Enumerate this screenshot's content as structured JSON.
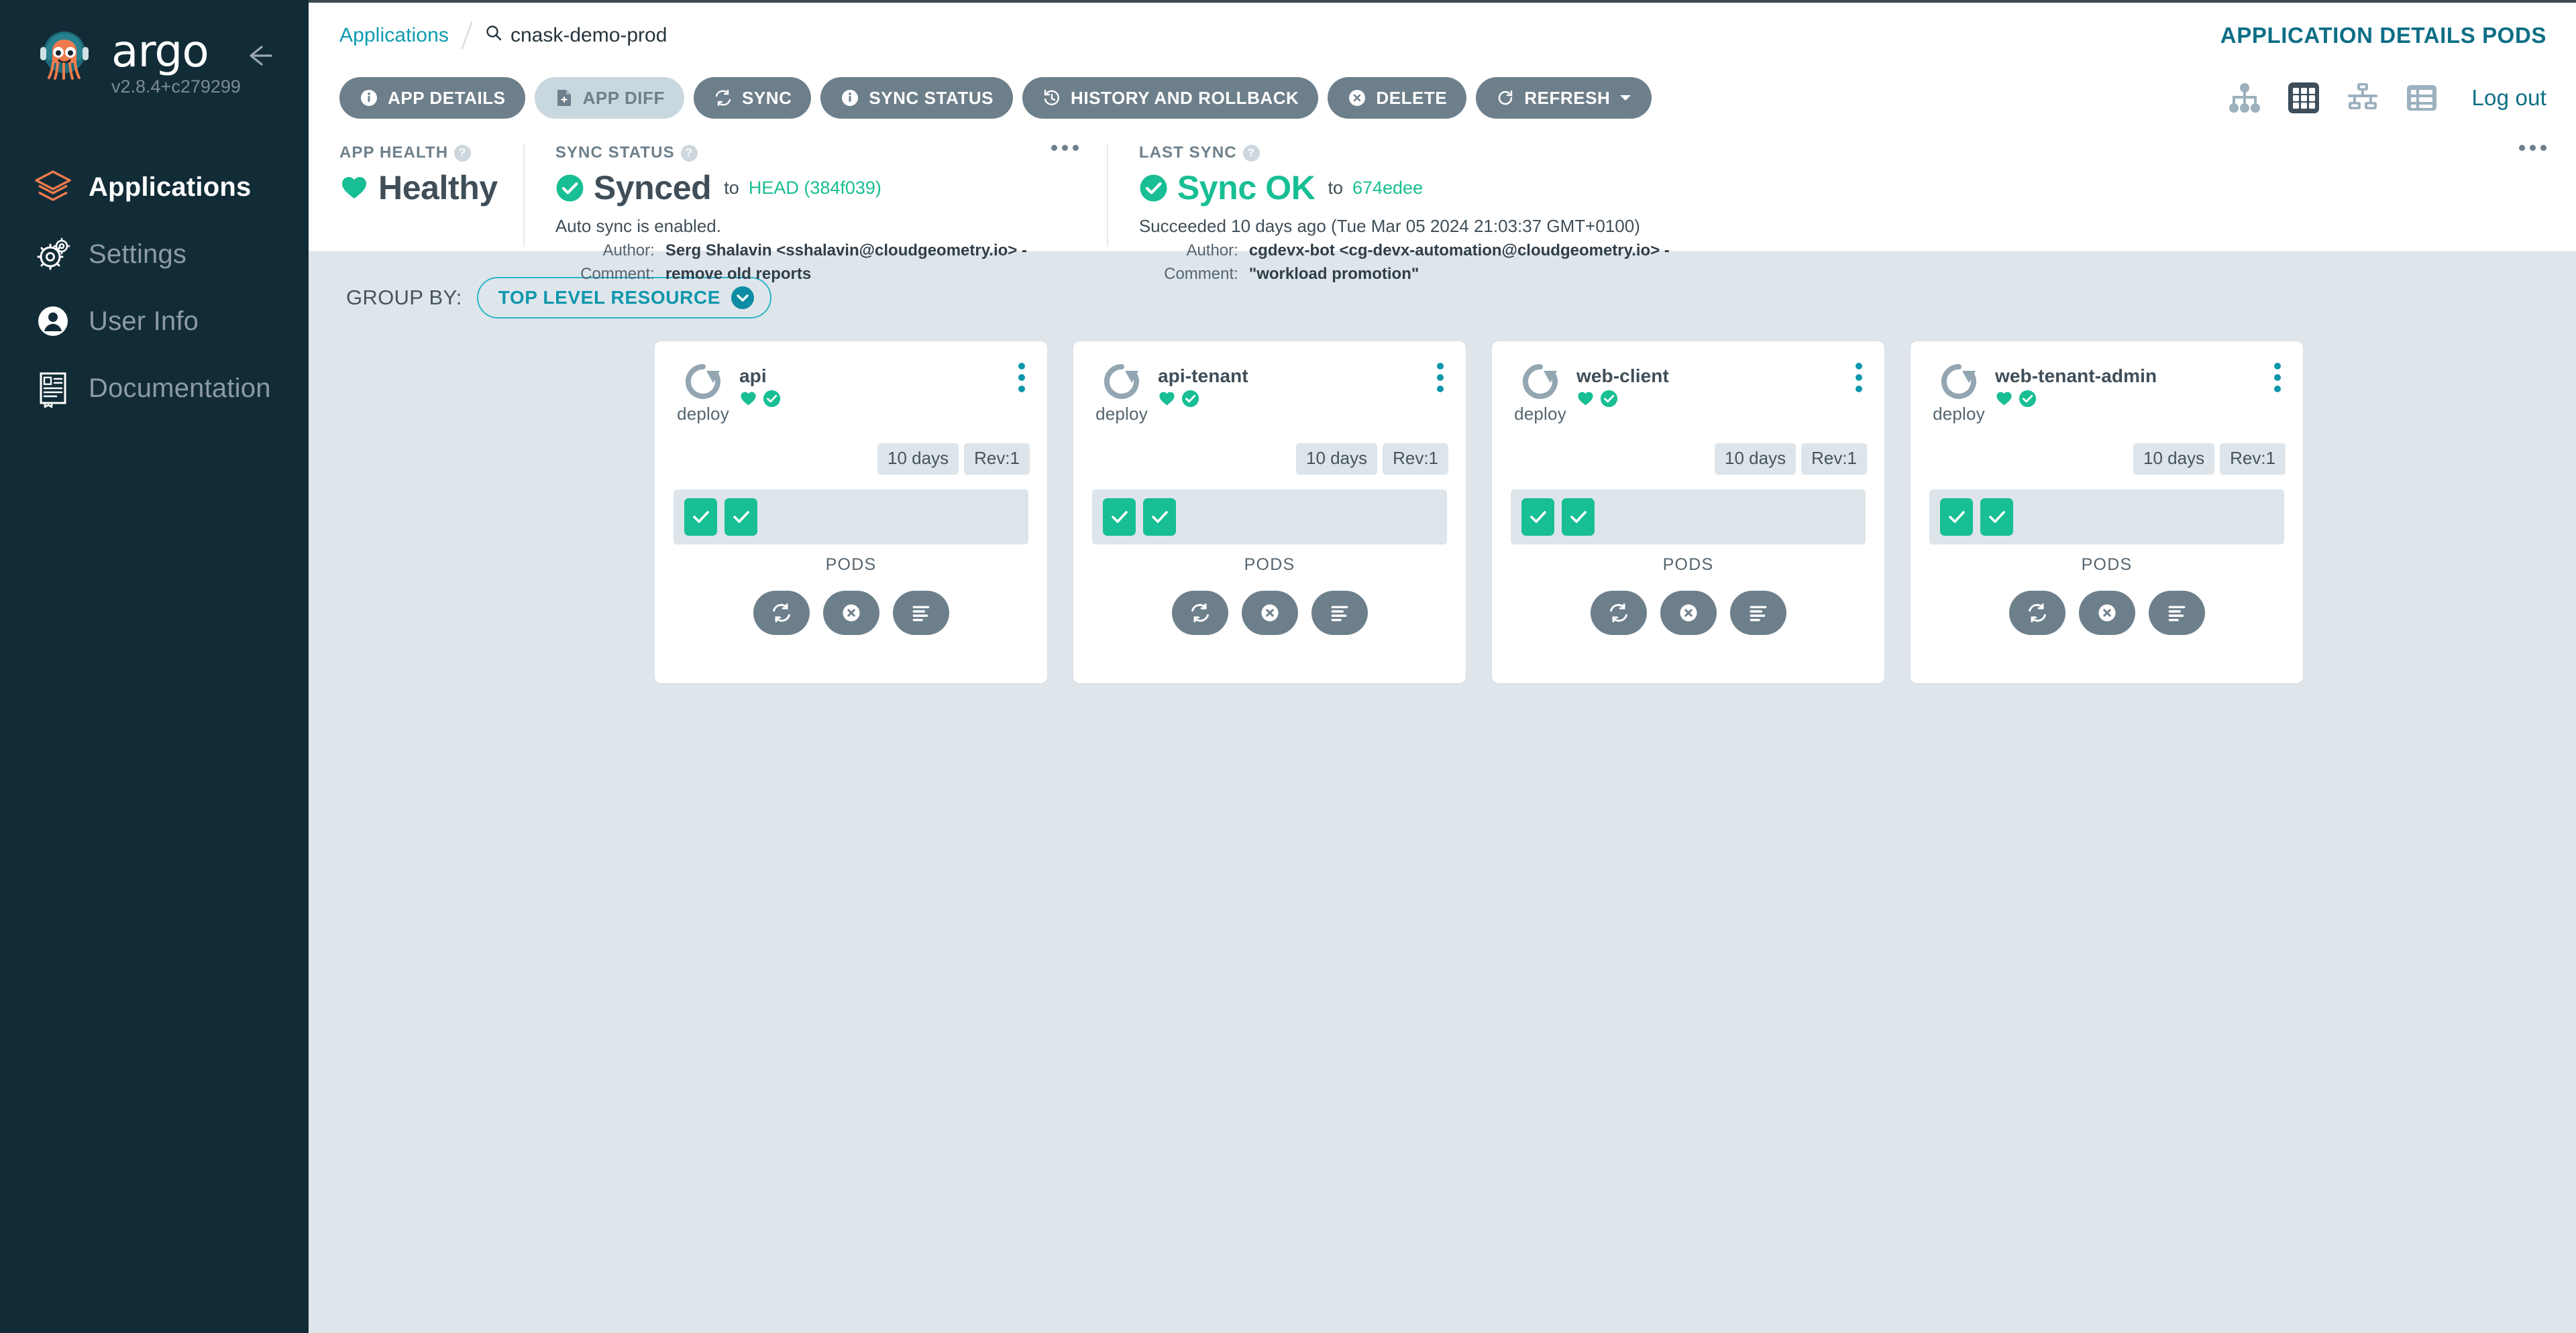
{
  "sidebar": {
    "brand": "argo",
    "version": "v2.8.4+c279299",
    "collapse_icon": "arrow-left-icon",
    "items": [
      {
        "label": "Applications",
        "icon": "layers-icon",
        "active": true
      },
      {
        "label": "Settings",
        "icon": "gear-icon",
        "active": false
      },
      {
        "label": "User Info",
        "icon": "user-circle-icon",
        "active": false
      },
      {
        "label": "Documentation",
        "icon": "book-icon",
        "active": false
      }
    ]
  },
  "header": {
    "breadcrumb_root": "Applications",
    "breadcrumb_current": "cnask-demo-prod",
    "breadcrumb_icon": "search-icon",
    "page_title": "APPLICATION DETAILS PODS"
  },
  "toolbar": {
    "buttons": [
      {
        "label": "APP DETAILS",
        "icon": "info-icon",
        "disabled": false
      },
      {
        "label": "APP DIFF",
        "icon": "file-diff-icon",
        "disabled": true
      },
      {
        "label": "SYNC",
        "icon": "sync-icon",
        "disabled": false
      },
      {
        "label": "SYNC STATUS",
        "icon": "info-icon",
        "disabled": false
      },
      {
        "label": "HISTORY AND ROLLBACK",
        "icon": "history-icon",
        "disabled": false
      },
      {
        "label": "DELETE",
        "icon": "close-icon",
        "disabled": false
      },
      {
        "label": "REFRESH",
        "icon": "refresh-icon",
        "disabled": false,
        "caret": true
      }
    ],
    "views": [
      {
        "name": "tree-view-icon",
        "active": false
      },
      {
        "name": "pods-view-icon",
        "active": true
      },
      {
        "name": "network-view-icon",
        "active": false
      },
      {
        "name": "list-view-icon",
        "active": false
      }
    ],
    "logout_label": "Log out"
  },
  "status": {
    "health": {
      "title": "APP HEALTH",
      "help_icon": "question-icon",
      "value": "Healthy",
      "icon": "heart-icon"
    },
    "sync": {
      "title": "SYNC STATUS",
      "help_icon": "question-icon",
      "menu_icon": "more-horizontal-icon",
      "value": "Synced",
      "to_label": "to",
      "revision": "HEAD (384f039)",
      "note": "Auto sync is enabled.",
      "author_key": "Author:",
      "author_value": "Serg Shalavin <sshalavin@cloudgeometry.io> -",
      "comment_key": "Comment:",
      "comment_value": "remove old reports"
    },
    "last_sync": {
      "title": "LAST SYNC",
      "help_icon": "question-icon",
      "menu_icon": "more-horizontal-icon",
      "value": "Sync OK",
      "to_label": "to",
      "revision": "674edee",
      "note": "Succeeded 10 days ago (Tue Mar 05 2024 21:03:37 GMT+0100)",
      "author_key": "Author:",
      "author_value": "cgdevx-bot <cg-devx-automation@cloudgeometry.io> -",
      "comment_key": "Comment:",
      "comment_value": "\"workload promotion\""
    }
  },
  "group_by": {
    "label": "GROUP BY:",
    "value": "TOP LEVEL RESOURCE",
    "chevron_icon": "chevron-down-icon"
  },
  "cards": [
    {
      "kind": "deploy",
      "kind_icon": "rollout-icon",
      "name": "api",
      "health_icon": "heart-icon",
      "sync_icon": "check-circle-icon",
      "age_tag": "10 days",
      "rev_tag": "Rev:1",
      "pods": [
        "healthy",
        "healthy"
      ],
      "pods_label": "PODS",
      "actions": [
        "sync-icon",
        "delete-icon",
        "logs-icon"
      ]
    },
    {
      "kind": "deploy",
      "kind_icon": "rollout-icon",
      "name": "api-tenant",
      "health_icon": "heart-icon",
      "sync_icon": "check-circle-icon",
      "age_tag": "10 days",
      "rev_tag": "Rev:1",
      "pods": [
        "healthy",
        "healthy"
      ],
      "pods_label": "PODS",
      "actions": [
        "sync-icon",
        "delete-icon",
        "logs-icon"
      ]
    },
    {
      "kind": "deploy",
      "kind_icon": "rollout-icon",
      "name": "web-client",
      "health_icon": "heart-icon",
      "sync_icon": "check-circle-icon",
      "age_tag": "10 days",
      "rev_tag": "Rev:1",
      "pods": [
        "healthy",
        "healthy"
      ],
      "pods_label": "PODS",
      "actions": [
        "sync-icon",
        "delete-icon",
        "logs-icon"
      ]
    },
    {
      "kind": "deploy",
      "kind_icon": "rollout-icon",
      "name": "web-tenant-admin",
      "health_icon": "heart-icon",
      "sync_icon": "check-circle-icon",
      "age_tag": "10 days",
      "rev_tag": "Rev:1",
      "pods": [
        "healthy",
        "healthy"
      ],
      "pods_label": "PODS",
      "actions": [
        "sync-icon",
        "delete-icon",
        "logs-icon"
      ]
    }
  ],
  "colors": {
    "sidebar_bg": "#122c37",
    "accent_teal": "#0d8ca3",
    "healthy_green": "#18be94",
    "argo_orange": "#ef7b4d",
    "page_bg": "#dee6ec",
    "button_grey": "#6d7f8b"
  }
}
